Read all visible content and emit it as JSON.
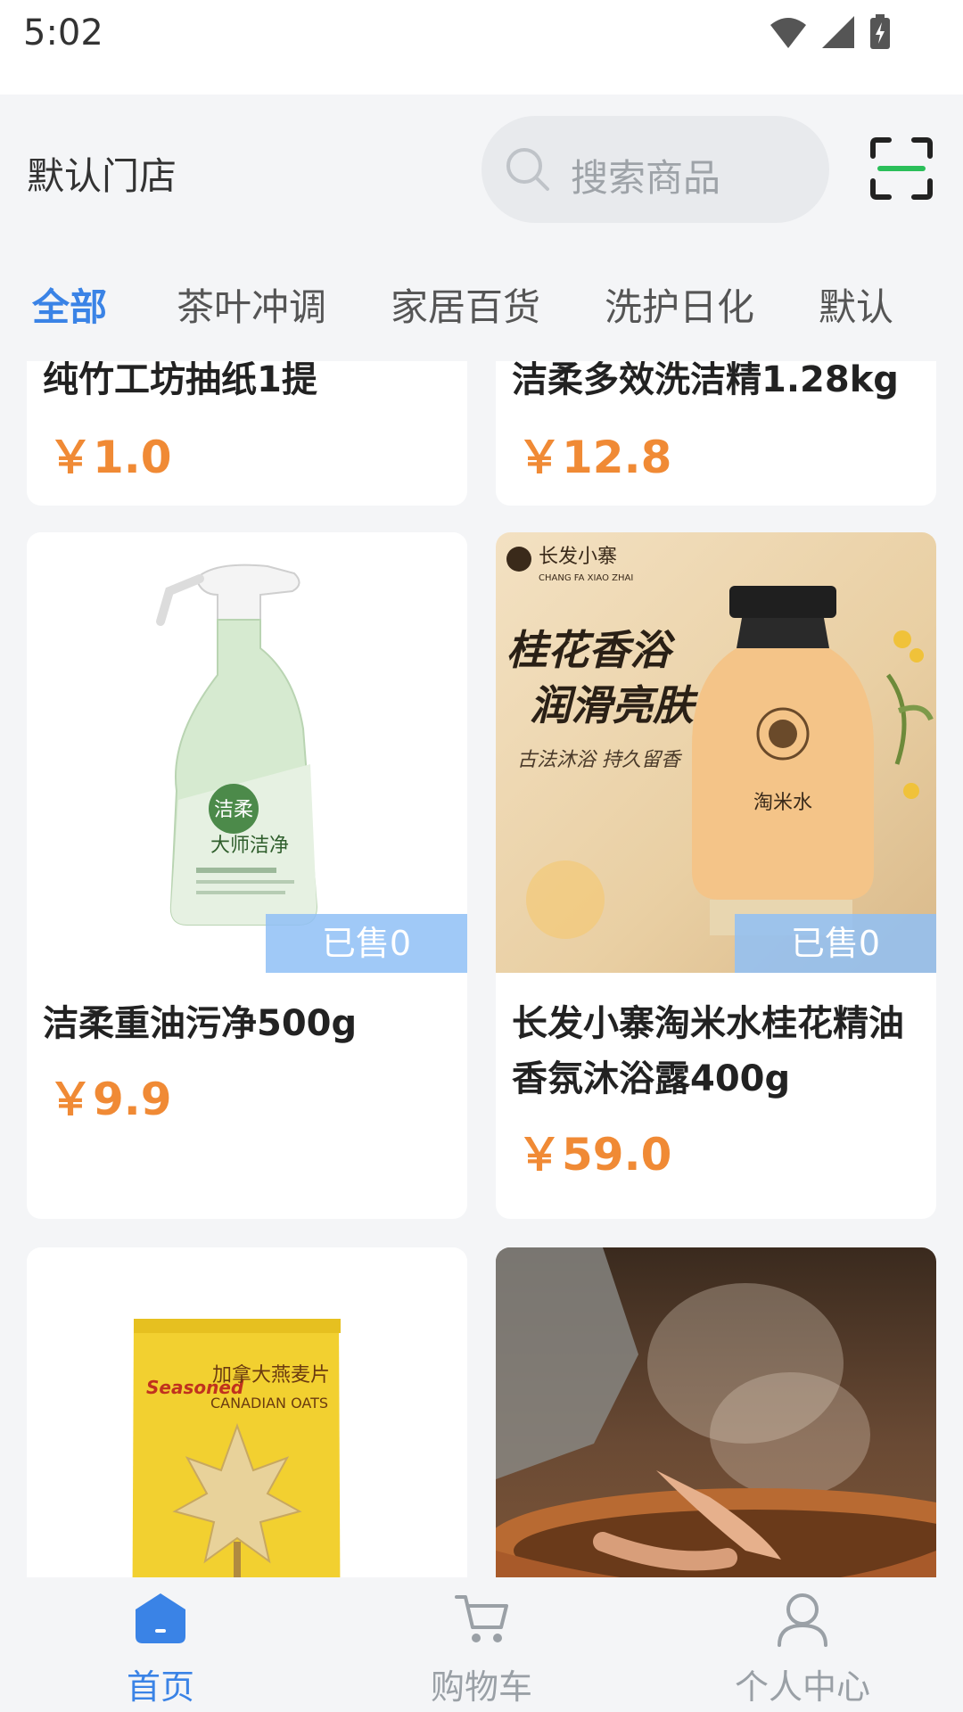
{
  "status_bar": {
    "time": "5:02"
  },
  "header": {
    "store_name": "默认门店",
    "search_placeholder": "搜索商品"
  },
  "tabs": [
    {
      "label": "全部",
      "active": true
    },
    {
      "label": "茶叶冲调",
      "active": false
    },
    {
      "label": "家居百货",
      "active": false
    },
    {
      "label": "洗护日化",
      "active": false
    },
    {
      "label": "默认",
      "active": false
    }
  ],
  "products": [
    {
      "name": "纯竹工坊抽纸1提",
      "price": "￥1.0"
    },
    {
      "name": "洁柔多效洗洁精1.28kg",
      "price": "￥12.8"
    },
    {
      "name": "洁柔重油污净500g",
      "price": "￥9.9",
      "sold": "已售0",
      "image_text": {
        "brand": "洁柔",
        "tagline": "大师洁净"
      }
    },
    {
      "name": "长发小寨淘米水桂花精油香氛沐浴露400g",
      "price": "￥59.0",
      "sold": "已售0",
      "image_text": {
        "brand": "长发小寨",
        "brand_en": "CHANG FA XIAO ZHAI",
        "headline1": "桂花香浴",
        "headline2": "润滑亮肤",
        "tagline": "古法沐浴  持久留香",
        "bottle": "淘米水"
      }
    },
    {
      "name": "",
      "price": "",
      "image_text": {
        "brand": "Seasoned",
        "title_cn": "加拿大燕麦片",
        "title_en": "CANADIAN OATS"
      }
    },
    {
      "name": "",
      "price": ""
    }
  ],
  "bottom_nav": [
    {
      "label": "首页",
      "icon": "home-icon",
      "active": true
    },
    {
      "label": "购物车",
      "icon": "cart-icon",
      "active": false
    },
    {
      "label": "个人中心",
      "icon": "user-icon",
      "active": false
    }
  ],
  "colors": {
    "accent": "#3a83e6",
    "price": "#f08a35",
    "background": "#f4f5f7",
    "scan_green": "#2bbf5a",
    "sold_badge": "#8fc0f6"
  }
}
